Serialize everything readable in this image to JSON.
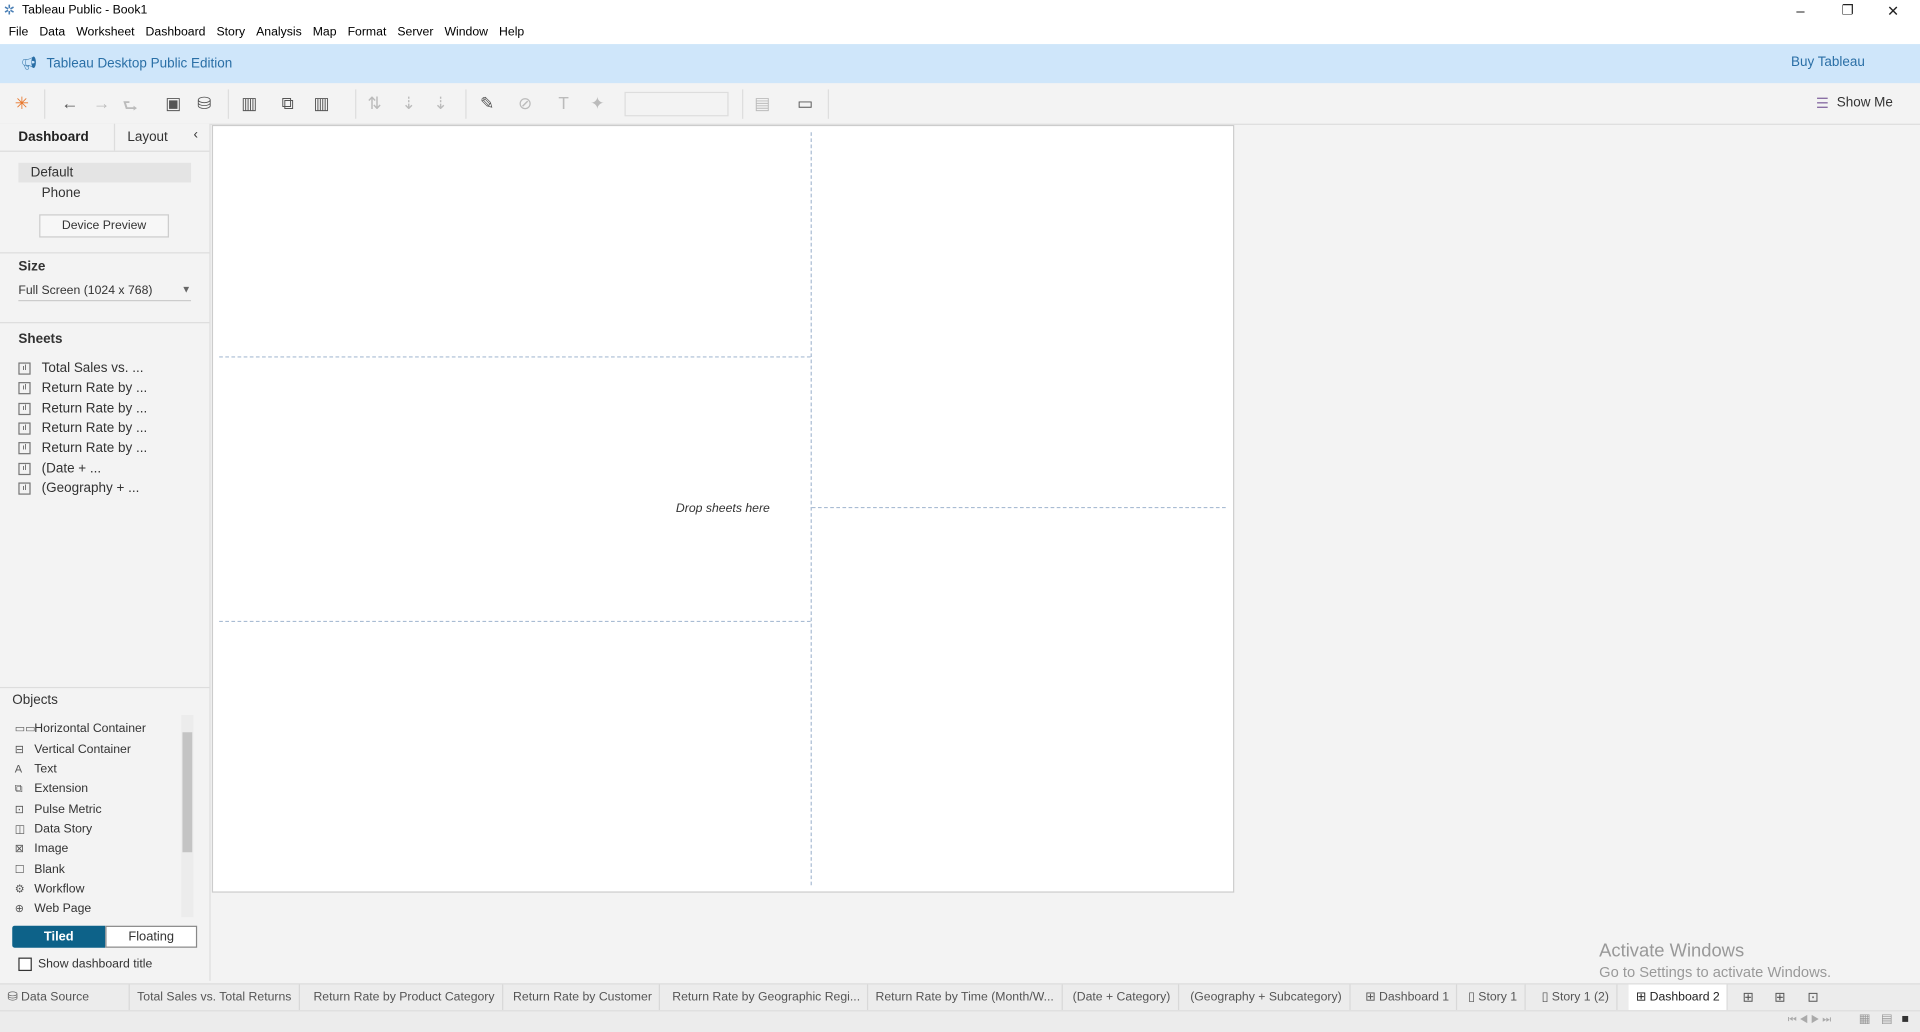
{
  "window": {
    "title": "Tableau Public - Book1",
    "minimize": "–",
    "restore": "❐",
    "close": "✕"
  },
  "menu": [
    "File",
    "Data",
    "Worksheet",
    "Dashboard",
    "Story",
    "Analysis",
    "Map",
    "Format",
    "Server",
    "Window",
    "Help"
  ],
  "banner": {
    "edition": "Tableau Desktop Public Edition",
    "buy": "Buy Tableau"
  },
  "toolbar": {
    "show_me": "Show Me"
  },
  "sidebar": {
    "tabs": [
      "Dashboard",
      "Layout"
    ],
    "devices": [
      "Default",
      "Phone"
    ],
    "device_preview": "Device Preview",
    "size_label": "Size",
    "size_value": "Full Screen (1024 x 768)",
    "sheets_label": "Sheets",
    "sheets": [
      "Total Sales vs. ...",
      "Return Rate by ...",
      "Return Rate by ...",
      "Return Rate by ...",
      "Return Rate by ...",
      "(Date + ...",
      "(Geography + ..."
    ],
    "objects_label": "Objects",
    "objects": [
      "Horizontal Container",
      "Vertical Container",
      "Text",
      "Extension",
      "Pulse Metric",
      "Data Story",
      "Image",
      "Blank",
      "Workflow",
      "Web Page"
    ],
    "tiled": "Tiled",
    "floating": "Floating",
    "show_title": "Show dashboard title"
  },
  "canvas": {
    "drop_hint": "Drop sheets here"
  },
  "tabs": [
    "Data Source",
    "Total Sales vs. Total Returns",
    "Return Rate by Product Category",
    "Return Rate by Customer",
    "Return Rate by Geographic Regi...",
    "Return Rate by Time (Month/W...",
    "(Date + Category)",
    "(Geography + Subcategory)",
    "Dashboard 1",
    "Story 1",
    "Story 1 (2)",
    "Dashboard 2"
  ],
  "watermark": {
    "title": "Activate Windows",
    "sub": "Go to Settings to activate Windows."
  },
  "colors": {
    "accent": "#0d6289",
    "banner": "#cfe6fa"
  }
}
